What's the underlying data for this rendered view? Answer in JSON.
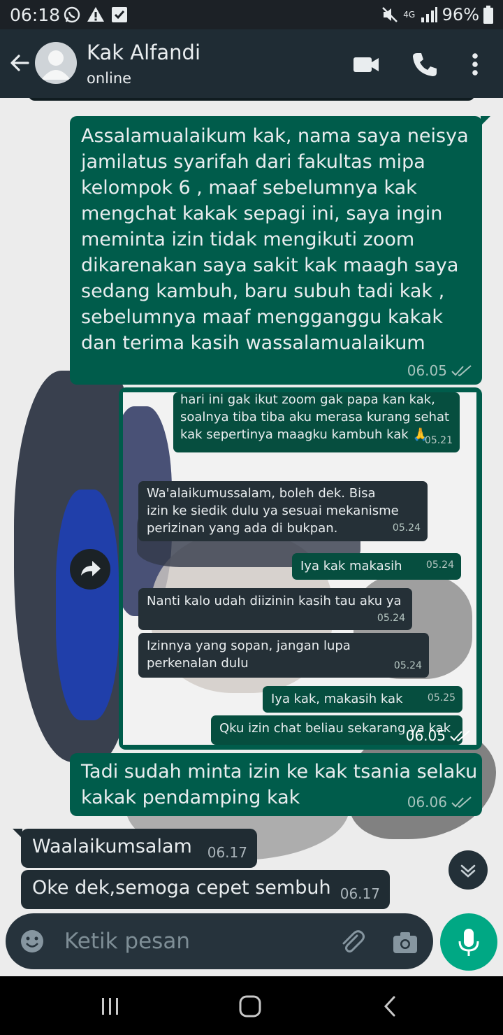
{
  "status_bar": {
    "time": "06:18",
    "network": "4G",
    "battery": "96%",
    "icons": [
      "whatsapp-icon",
      "warning-icon",
      "download-check-icon",
      "mute-icon",
      "signal-icon",
      "battery-icon"
    ]
  },
  "header": {
    "contact_name": "Kak Alfandi",
    "status": "online",
    "icons": [
      "back-arrow-icon",
      "video-call-icon",
      "phone-icon",
      "more-vert-icon"
    ]
  },
  "messages": [
    {
      "direction": "outgoing",
      "text": "Assalamualaikum kak, nama saya neisya\njamilatus syarifah dari fakultas mipa\nkelompok 6 , maaf sebelumnya kak\nmengchat  kakak sepagi ini, saya ingin\nmeminta izin tidak mengikuti zoom\ndikarenakan saya sakit kak maagh saya\nsedang kambuh, baru subuh tadi kak ,\nsebelumnya maaf mengganggu kakak\ndan terima kasih wassalamualaikum",
      "time": "06.05"
    },
    {
      "direction": "outgoing",
      "type": "image",
      "time": "06.05",
      "image_messages": [
        {
          "direction": "outgoing",
          "text": "hari ini gak ikut zoom gak papa kan kak,\nsoalnya tiba tiba aku merasa kurang sehat\nkak sepertinya maagku kambuh kak 🙏",
          "time": "05.21"
        },
        {
          "direction": "incoming",
          "text": "Wa'alaikumussalam, boleh dek. Bisa\nizin ke siedik dulu ya sesuai mekanisme\nperizinan yang ada di bukpan.",
          "time": "05.24"
        },
        {
          "direction": "outgoing",
          "text": "Iya kak makasih",
          "time": "05.24"
        },
        {
          "direction": "incoming",
          "text": "Nanti kalo udah diizinin kasih tau aku ya",
          "time": "05.24"
        },
        {
          "direction": "incoming",
          "text": "Izinnya yang sopan, jangan lupa\nperkenalan dulu",
          "time": "05.24"
        },
        {
          "direction": "outgoing",
          "text": "Iya kak, makasih kak",
          "time": "05.25"
        },
        {
          "direction": "outgoing",
          "text": "Qku izin chat beliau sekarang ya kak",
          "time": ""
        }
      ]
    },
    {
      "direction": "outgoing",
      "text": "Tadi sudah minta izin ke kak tsania selaku\nkakak pendamping kak",
      "time": "06.06"
    },
    {
      "direction": "incoming",
      "text": "Waalaikumsalam",
      "time": "06.17"
    },
    {
      "direction": "incoming",
      "text": "Oke dek,semoga cepet sembuh",
      "time": "06.17"
    }
  ],
  "composer": {
    "placeholder": "Ketik pesan",
    "icons": [
      "emoji-icon",
      "attach-icon",
      "camera-icon",
      "mic-icon"
    ]
  },
  "colors": {
    "outgoing_bubble": "#005c4b",
    "incoming_bubble": "#202c33",
    "header": "#1f2c34",
    "accent": "#00a884"
  }
}
